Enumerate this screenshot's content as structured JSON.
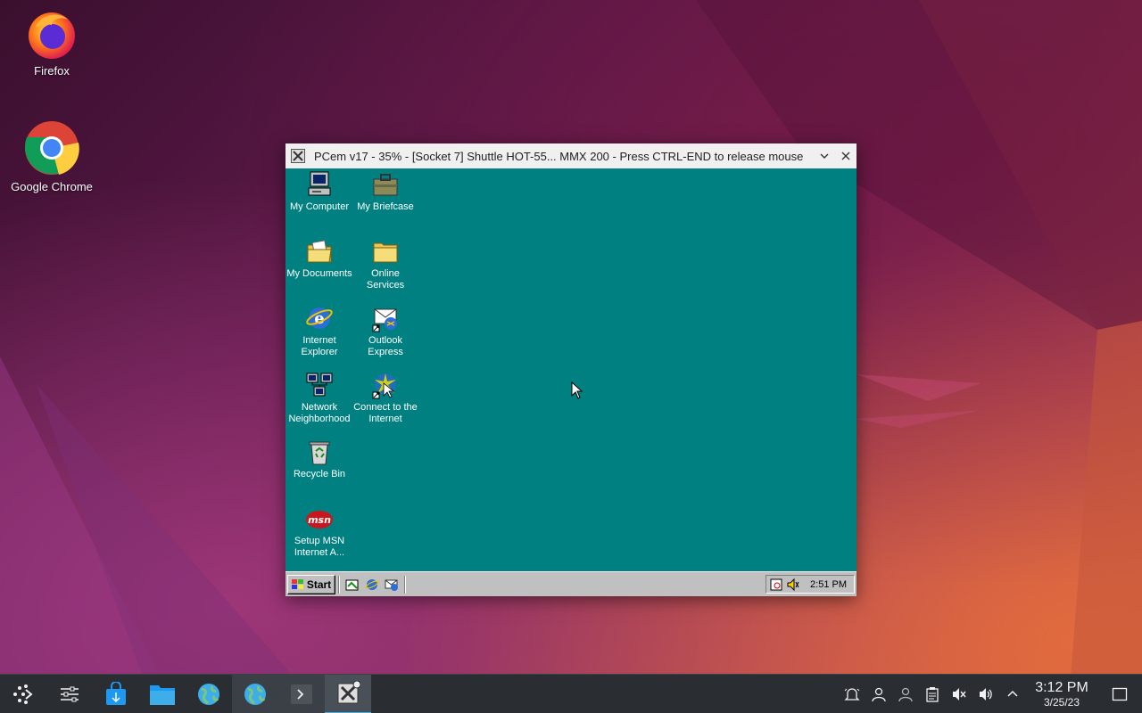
{
  "desktop": {
    "icons": [
      {
        "label": "Firefox"
      },
      {
        "label": "Google Chrome"
      }
    ]
  },
  "window": {
    "title": "PCem v17 - 35% - [Socket 7] Shuttle HOT-55... MMX 200 - Press CTRL-END to release mouse"
  },
  "win98": {
    "icons": [
      {
        "label": "My Computer",
        "icon": "my-computer-icon"
      },
      {
        "label": "My Briefcase",
        "icon": "briefcase-icon"
      },
      {
        "label": "My Documents",
        "icon": "my-documents-icon"
      },
      {
        "label": "Online Services",
        "icon": "folder-icon"
      },
      {
        "label": "Internet Explorer",
        "icon": "internet-explorer-icon"
      },
      {
        "label": "Outlook Express",
        "icon": "outlook-express-icon"
      },
      {
        "label": "Network Neighborhood",
        "icon": "network-icon"
      },
      {
        "label": "Connect to the Internet",
        "icon": "connect-internet-icon"
      },
      {
        "label": "Recycle Bin",
        "icon": "recycle-bin-icon"
      },
      {
        "label": "Setup MSN Internet A...",
        "icon": "msn-icon",
        "badge": "msn"
      }
    ],
    "taskbar": {
      "start_label": "Start",
      "clock": "2:51 PM"
    }
  },
  "panel": {
    "clock_time": "3:12 PM",
    "clock_date": "3/25/23"
  },
  "colors": {
    "win98_desktop": "#008080",
    "win98_taskbar": "#c0c0c0",
    "kde_panel": "#2a2e32",
    "kde_accent": "#3daee9"
  }
}
